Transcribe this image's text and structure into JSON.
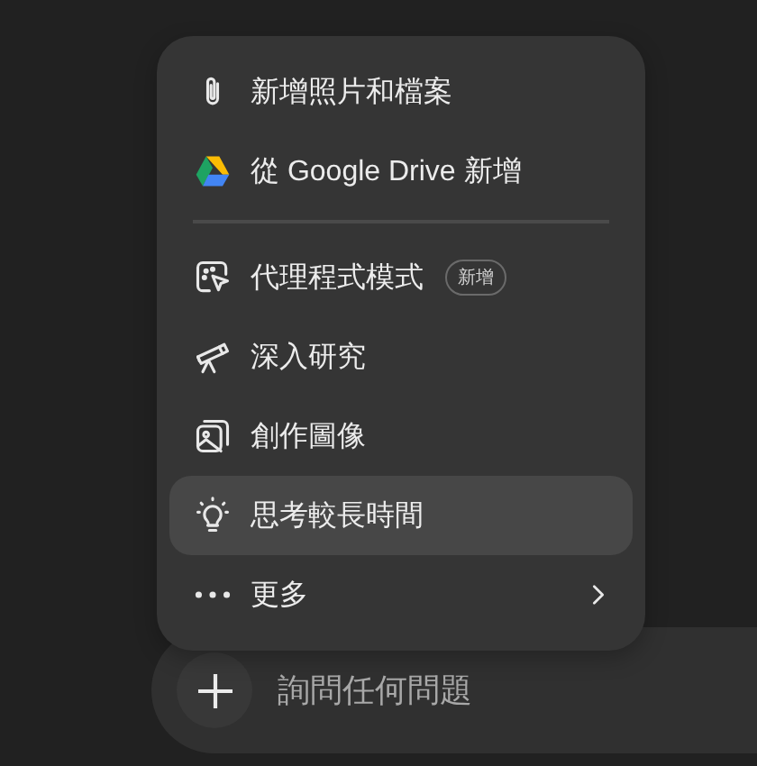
{
  "menu": {
    "items": [
      {
        "kind": "item",
        "label": "新增照片和檔案",
        "selected": false
      },
      {
        "kind": "item",
        "label": "從 Google Drive 新增",
        "selected": false
      },
      {
        "kind": "divider"
      },
      {
        "kind": "item",
        "label": "代理程式模式",
        "badge": "新增",
        "selected": false
      },
      {
        "kind": "item",
        "label": "深入研究",
        "selected": false
      },
      {
        "kind": "item",
        "label": "創作圖像",
        "selected": false
      },
      {
        "kind": "item",
        "label": "思考較長時間",
        "selected": true
      },
      {
        "kind": "submenu",
        "label": "更多",
        "selected": false
      }
    ]
  },
  "composer": {
    "placeholder": "詢問任何問題"
  }
}
